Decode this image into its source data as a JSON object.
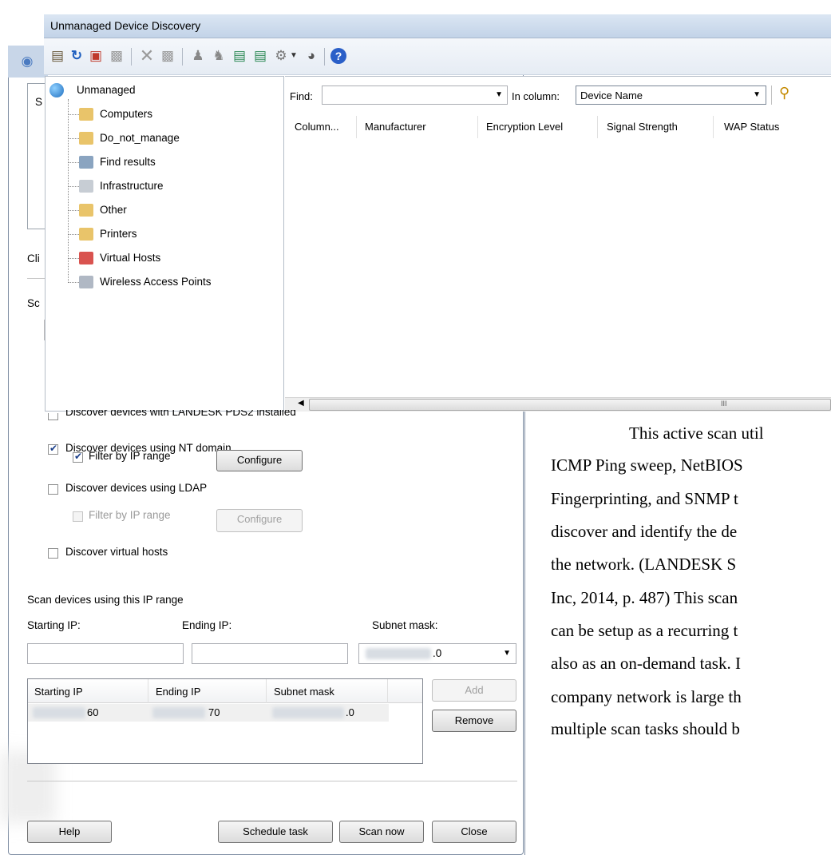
{
  "window": {
    "title": "Unmanaged Device Discovery"
  },
  "toolbar": {
    "icons": [
      "discover-icon",
      "refresh-icon",
      "folder-icon",
      "move-icon",
      "delete-icon",
      "remove-device-icon",
      "person-icon",
      "agent-icon",
      "db-icon",
      "db-export-icon",
      "tools-icon",
      "dropdown-icon",
      "disk-icon",
      "help-icon"
    ]
  },
  "tree": {
    "root": "Unmanaged",
    "items": [
      "Computers",
      "Do_not_manage",
      "Find results",
      "Infrastructure",
      "Other",
      "Printers",
      "Virtual Hosts",
      "Wireless Access Points"
    ]
  },
  "find": {
    "label": "Find:",
    "value": "",
    "in_column_label": "In column:",
    "column_value": "Device Name"
  },
  "grid": {
    "columns": [
      "Column...",
      "Manufacturer",
      "Encryption Level",
      "Signal Strength",
      "WAP Status"
    ],
    "scroll_glyph": "III"
  },
  "underlay": {
    "partial_labels": [
      "S",
      "Cli",
      "Sc"
    ]
  },
  "dialog": {
    "opt_pds2": "Discover devices with LANDESK PDS2 installed",
    "opt_nt": "Discover devices using NT domain",
    "opt_nt_filter": "Filter by IP range",
    "configure1": "Configure",
    "opt_ldap": "Discover devices using LDAP",
    "opt_ldap_filter": "Filter by IP range",
    "configure2": "Configure",
    "opt_virtual": "Discover virtual hosts",
    "range_heading": "Scan devices using this IP range",
    "starting_ip_label": "Starting IP:",
    "ending_ip_label": "Ending IP:",
    "subnet_label": "Subnet mask:",
    "subnet_value": ".0",
    "table_headers": [
      "Starting IP",
      "Ending IP",
      "Subnet mask"
    ],
    "row": {
      "start": "60",
      "end": "70",
      "mask": ".0"
    },
    "add": "Add",
    "remove": "Remove",
    "help": "Help",
    "schedule": "Schedule task",
    "scan_now": "Scan now",
    "close": "Close"
  },
  "document_text": [
    "This active scan util",
    "ICMP Ping sweep, NetBIOS",
    "Fingerprinting, and SNMP t",
    "discover and identify the de",
    "the network. (LANDESK S",
    "Inc, 2014, p. 487)  This scan",
    "can be setup as a recurring t",
    "also as an on-demand task. I",
    "company network is large th",
    "multiple scan tasks should b"
  ]
}
